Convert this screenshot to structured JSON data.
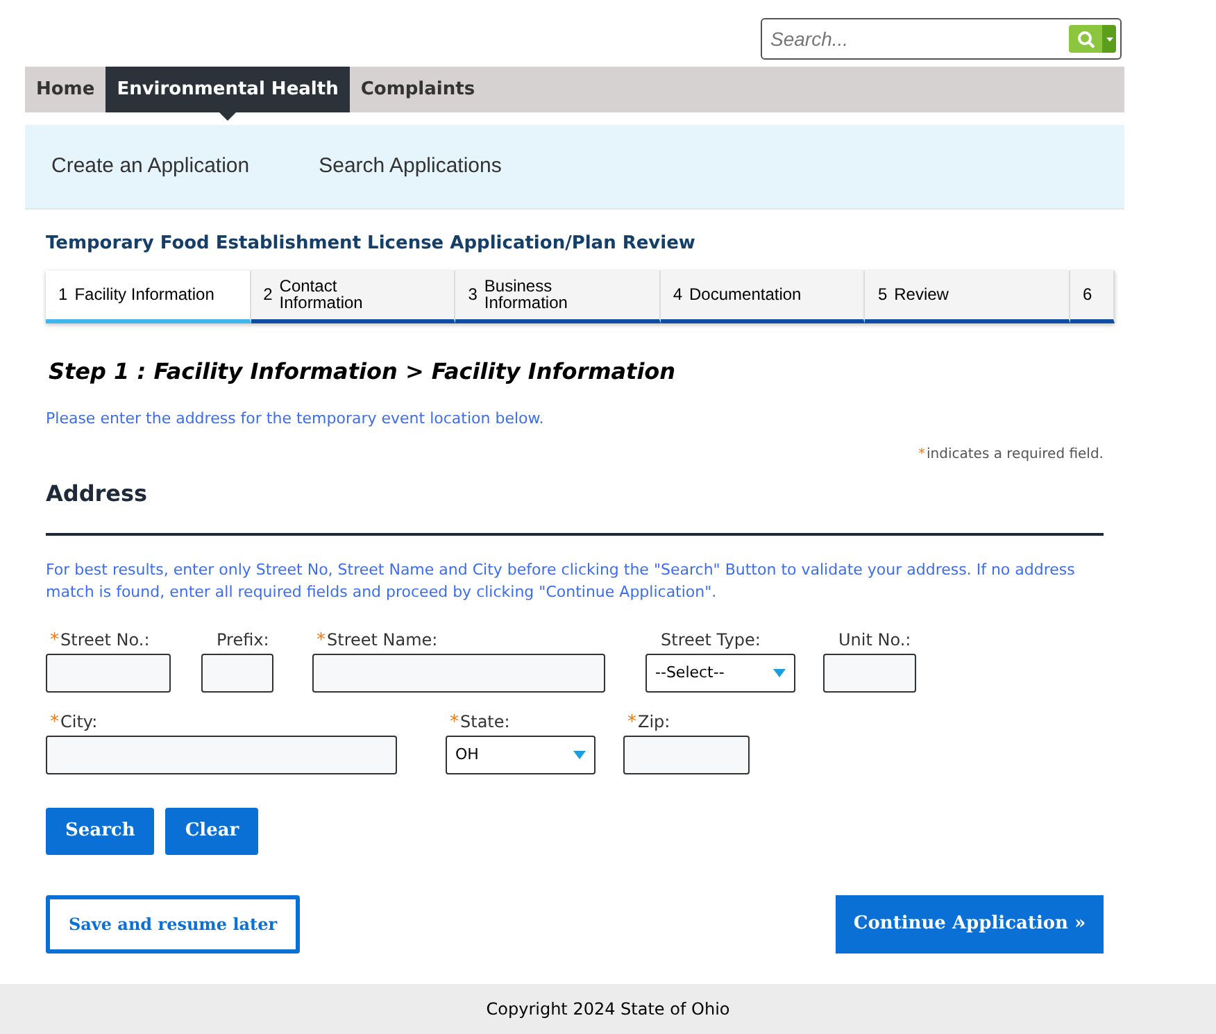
{
  "search": {
    "placeholder": "Search..."
  },
  "nav": [
    {
      "label": "Home",
      "selected": false
    },
    {
      "label": "Environmental Health",
      "selected": true
    },
    {
      "label": "Complaints",
      "selected": false
    }
  ],
  "subnav": [
    "Create an Application",
    "Search Applications"
  ],
  "title": "Temporary Food Establishment License Application/Plan Review",
  "steps": [
    {
      "number": "1",
      "label": "Facility Information",
      "selected": true
    },
    {
      "number": "2",
      "label": "Contact Information",
      "selected": false
    },
    {
      "number": "3",
      "label": "Business Information",
      "selected": false
    },
    {
      "number": "4",
      "label": "Documentation",
      "selected": false
    },
    {
      "number": "5",
      "label": "Review",
      "selected": false
    },
    {
      "number": "6",
      "selected": false
    }
  ],
  "step_heading": "Step 1 : Facility Information > Facility Information",
  "intro": "Please enter the address for the temporary event location below.",
  "required_mark": "*",
  "required_note": "indicates a required field.",
  "section_title": "Address",
  "instructions": "For best results, enter only Street No, Street Name and City before clicking the \"Search\" Button to validate your address. If no address match is found, enter all required fields and proceed by clicking \"Continue Application\".",
  "field_rows": [
    [
      {
        "label": "Street No.:",
        "required": true,
        "kind": "text"
      },
      {
        "label": "Prefix:",
        "required": false,
        "kind": "text"
      },
      {
        "label": "Street Name:",
        "required": true,
        "kind": "text"
      },
      {
        "label": "Street Type:",
        "required": false,
        "kind": "select",
        "value": "--Select--"
      },
      {
        "label": "Unit No.:",
        "required": false,
        "kind": "text"
      }
    ],
    [
      {
        "label": "City:",
        "required": true,
        "kind": "text"
      },
      {
        "label": "State:",
        "required": true,
        "kind": "select",
        "value": "OH"
      },
      {
        "label": "Zip:",
        "required": true,
        "kind": "text"
      }
    ]
  ],
  "form_buttons": [
    "Search",
    "Clear"
  ],
  "save_button": "Save and resume later",
  "continue_button": "Continue Application »",
  "footer": "Copyright 2024 State of Ohio"
}
